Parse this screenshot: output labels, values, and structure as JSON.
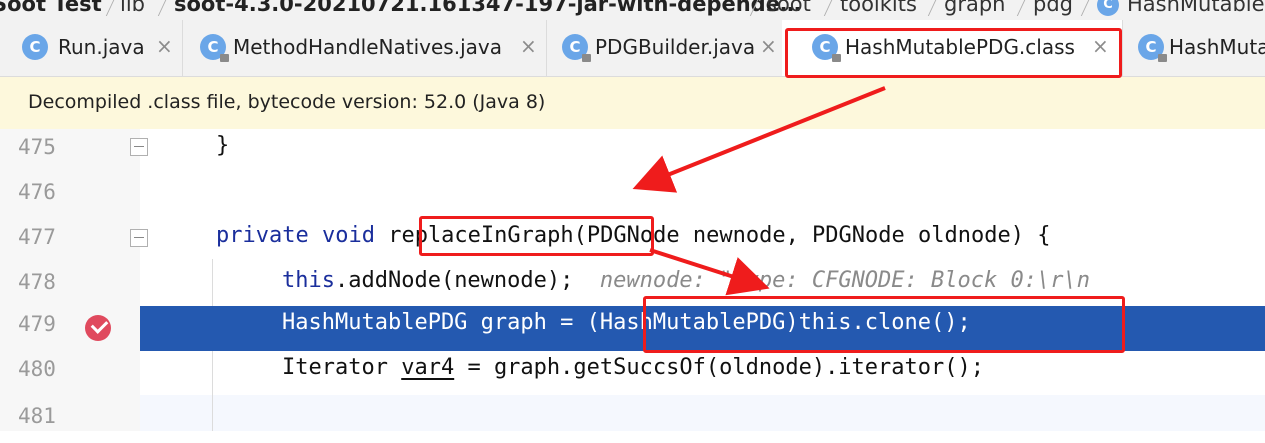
{
  "breadcrumb": [
    {
      "label": "Soot Test",
      "bold": true
    },
    {
      "label": "lib",
      "bold": false
    },
    {
      "label": "soot-4.3.0-20210721.161347-197-jar-with-depende…",
      "bold": true
    },
    {
      "label": "soot",
      "bold": false
    },
    {
      "label": "toolkits",
      "bold": false
    },
    {
      "label": "graph",
      "bold": false
    },
    {
      "label": "pdg",
      "bold": false
    },
    {
      "label": "HashMutable",
      "bold": false
    }
  ],
  "tabs": [
    {
      "label": "Run.java",
      "icon": "class-c-icon",
      "close": "×"
    },
    {
      "label": "MethodHandleNatives.java",
      "icon": "class-c-locked-icon",
      "close": "×"
    },
    {
      "label": "PDGBuilder.java",
      "icon": "class-c-locked-icon",
      "close": "×"
    },
    {
      "label": "HashMutablePDG.class",
      "icon": "class-c-locked-icon",
      "close": "×",
      "active": true
    },
    {
      "label": "HashMuta",
      "icon": "class-c-locked-icon"
    }
  ],
  "banner": {
    "text": "Decompiled .class file, bytecode version: 52.0 (Java 8)"
  },
  "icon_letter": "C",
  "code": {
    "lines": [
      {
        "num": "475",
        "brace": "}"
      },
      {
        "num": "476"
      },
      {
        "num": "477",
        "kw1": "private",
        "kw2": "void",
        "method": "replaceInGraph",
        "rest": "(PDGNode newnode, PDGNode oldnode) {"
      },
      {
        "num": "478",
        "kw": "this",
        "rest": ".addNode(newnode);",
        "hint": "newnode: \"Type: CFGNODE: Block 0:\\r\\n"
      },
      {
        "num": "479",
        "type": "HashMutablePDG graph = ",
        "cast": "(HashMutablePDG)this.clone();"
      },
      {
        "num": "480",
        "pre": "Iterator ",
        "var": "var4",
        "rest": " = graph.getSuccsOf(oldnode).iterator();"
      },
      {
        "num": "481"
      }
    ]
  },
  "colors": {
    "annotation": "#ef1c1c",
    "selection": "#2459b0",
    "keyword": "#1a2e9c",
    "banner": "#fdf8dc"
  }
}
